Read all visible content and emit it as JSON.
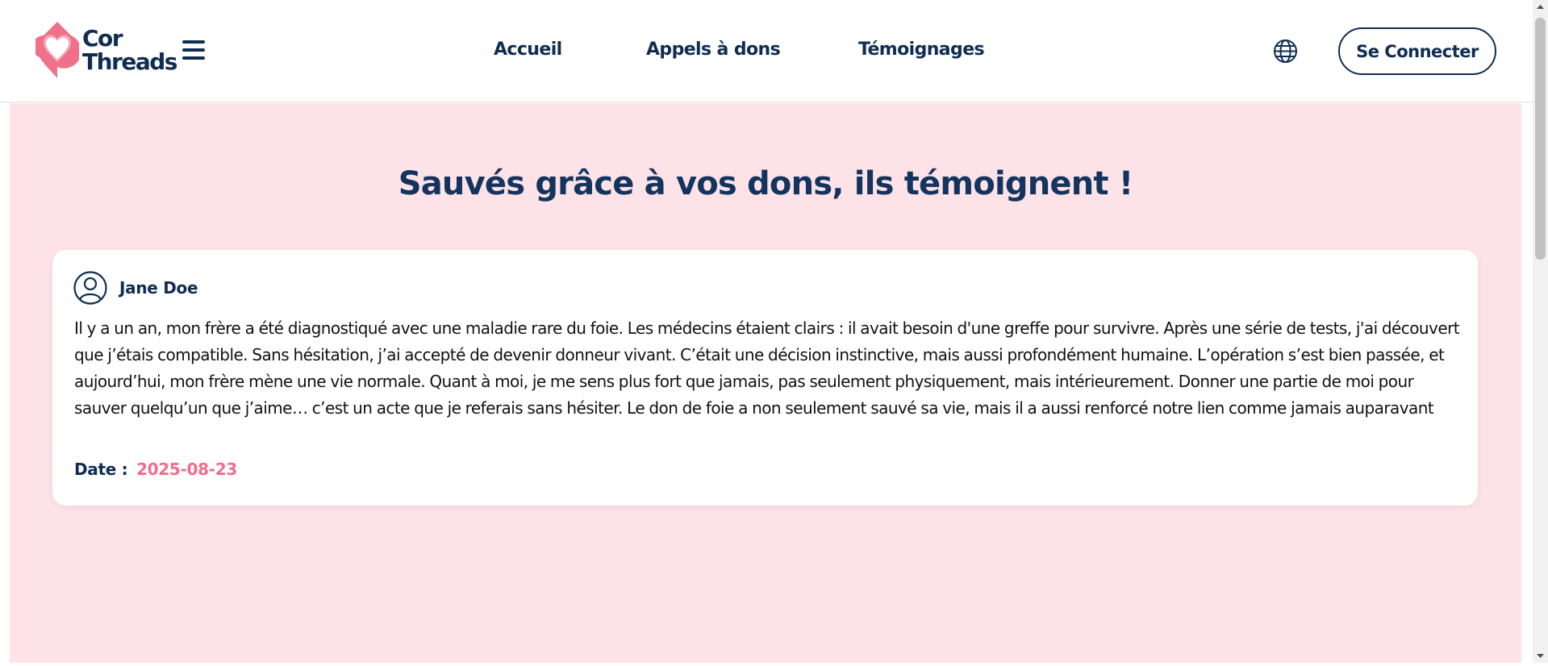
{
  "header": {
    "logo": {
      "line1": "Cor",
      "line2": "Threads",
      "icon": "heart-drop-icon"
    },
    "menu_icon": "hamburger-menu-icon",
    "nav": [
      {
        "label": "Accueil"
      },
      {
        "label": "Appels à dons"
      },
      {
        "label": "Témoignages"
      }
    ],
    "language_icon": "globe-icon",
    "login_label": "Se Connecter"
  },
  "main": {
    "title": "Sauvés grâce à vos dons, ils témoignent !",
    "testimonials": [
      {
        "author": "Jane Doe",
        "avatar_icon": "user-circle-icon",
        "text": "Il y a un an, mon frère a été diagnostiqué avec une maladie rare du foie. Les médecins étaient clairs : il avait besoin d'une greffe pour survivre. Après une série de tests, j'ai découvert que j’étais compatible. Sans hésitation, j’ai accepté de devenir donneur vivant. C’était une décision instinctive, mais aussi profondément humaine. L’opération s’est bien passée, et aujourd’hui, mon frère mène une vie normale. Quant à moi, je me sens plus fort que jamais, pas seulement physiquement, mais intérieurement. Donner une partie de moi pour sauver quelqu’un que j’aime… c’est un acte que je referais sans hésiter. Le don de foie a non seulement sauvé sa vie, mais il a aussi renforcé notre lien comme jamais auparavant",
        "date_label": "Date :",
        "date": "2025-08-23"
      }
    ]
  },
  "colors": {
    "navy": "#0f2d52",
    "pink_background": "#fde2e7",
    "accent_pink": "#f06e8c",
    "logo_pink": "#f0708a"
  }
}
